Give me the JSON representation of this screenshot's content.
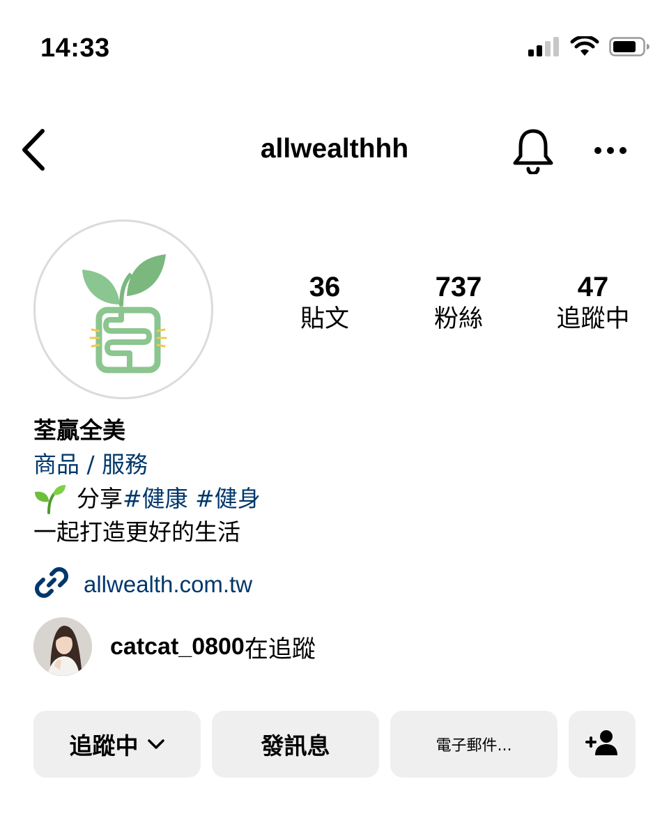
{
  "status_bar": {
    "time": "14:33",
    "signal_icon": "cellular-signal-icon",
    "wifi_icon": "wifi-icon",
    "battery_icon": "battery-icon"
  },
  "nav": {
    "title": "allwealthhh",
    "back_icon": "chevron-left-icon",
    "bell_icon": "bell-icon",
    "more_icon": "more-horizontal-icon"
  },
  "profile": {
    "stats": [
      {
        "value": "36",
        "label": "貼文"
      },
      {
        "value": "737",
        "label": "粉絲"
      },
      {
        "value": "47",
        "label": "追蹤中"
      }
    ],
    "name": "荃贏全美",
    "category": "商品 / 服務",
    "bio_line1_prefix": "分享",
    "bio_line1_tag1": "#健康",
    "bio_line1_tag2": "#健身",
    "bio_line2": "一起打造更好的生活",
    "link": "allwealth.com.tw",
    "mutual_user": "catcat_0800",
    "mutual_suffix": "在追蹤"
  },
  "buttons": {
    "following": "追蹤中",
    "message": "發訊息",
    "email": "電子郵件...",
    "add_user_icon": "add-user-icon"
  },
  "colors": {
    "link_blue": "#00376b",
    "button_bg": "#efefef",
    "logo_green_light": "#8bc58f",
    "logo_green_dark": "#5aa05e",
    "logo_yellow": "#f2c94c"
  }
}
